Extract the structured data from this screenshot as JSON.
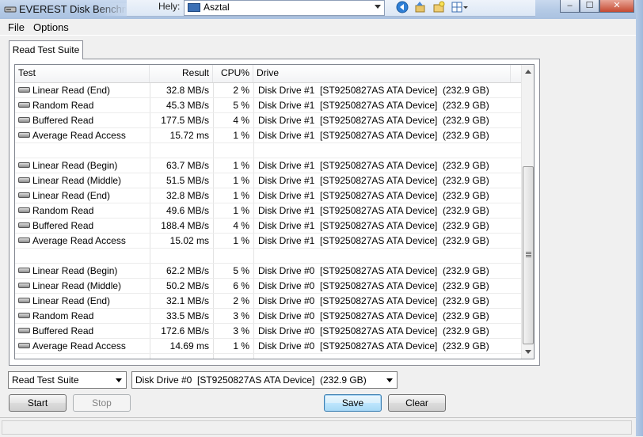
{
  "window": {
    "title": "EVEREST Disk Benchmark",
    "location_label": "Hely:",
    "location_value": "Asztal",
    "controls": [
      "minimize",
      "maximize",
      "close"
    ]
  },
  "menu": {
    "items": [
      {
        "label": "File"
      },
      {
        "label": "Options"
      }
    ]
  },
  "tabs": [
    {
      "label": "Read Test Suite",
      "active": true
    }
  ],
  "table": {
    "columns": [
      "Test",
      "Result",
      "CPU%",
      "Drive"
    ],
    "rows": [
      {
        "test": "Linear Read (End)",
        "result": "32.8 MB/s",
        "cpu": "2 %",
        "drive": "Disk Drive #1  [ST9250827AS ATA Device]  (232.9 GB)"
      },
      {
        "test": "Random Read",
        "result": "45.3 MB/s",
        "cpu": "5 %",
        "drive": "Disk Drive #1  [ST9250827AS ATA Device]  (232.9 GB)"
      },
      {
        "test": "Buffered Read",
        "result": "177.5 MB/s",
        "cpu": "4 %",
        "drive": "Disk Drive #1  [ST9250827AS ATA Device]  (232.9 GB)"
      },
      {
        "test": "Average Read Access",
        "result": "15.72 ms",
        "cpu": "1 %",
        "drive": "Disk Drive #1  [ST9250827AS ATA Device]  (232.9 GB)"
      },
      {
        "test": "",
        "result": "",
        "cpu": "",
        "drive": ""
      },
      {
        "test": "Linear Read (Begin)",
        "result": "63.7 MB/s",
        "cpu": "1 %",
        "drive": "Disk Drive #1  [ST9250827AS ATA Device]  (232.9 GB)"
      },
      {
        "test": "Linear Read (Middle)",
        "result": "51.5 MB/s",
        "cpu": "1 %",
        "drive": "Disk Drive #1  [ST9250827AS ATA Device]  (232.9 GB)"
      },
      {
        "test": "Linear Read (End)",
        "result": "32.8 MB/s",
        "cpu": "1 %",
        "drive": "Disk Drive #1  [ST9250827AS ATA Device]  (232.9 GB)"
      },
      {
        "test": "Random Read",
        "result": "49.6 MB/s",
        "cpu": "1 %",
        "drive": "Disk Drive #1  [ST9250827AS ATA Device]  (232.9 GB)"
      },
      {
        "test": "Buffered Read",
        "result": "188.4 MB/s",
        "cpu": "4 %",
        "drive": "Disk Drive #1  [ST9250827AS ATA Device]  (232.9 GB)"
      },
      {
        "test": "Average Read Access",
        "result": "15.02 ms",
        "cpu": "1 %",
        "drive": "Disk Drive #1  [ST9250827AS ATA Device]  (232.9 GB)"
      },
      {
        "test": "",
        "result": "",
        "cpu": "",
        "drive": ""
      },
      {
        "test": "Linear Read (Begin)",
        "result": "62.2 MB/s",
        "cpu": "5 %",
        "drive": "Disk Drive #0  [ST9250827AS ATA Device]  (232.9 GB)"
      },
      {
        "test": "Linear Read (Middle)",
        "result": "50.2 MB/s",
        "cpu": "6 %",
        "drive": "Disk Drive #0  [ST9250827AS ATA Device]  (232.9 GB)"
      },
      {
        "test": "Linear Read (End)",
        "result": "32.1 MB/s",
        "cpu": "2 %",
        "drive": "Disk Drive #0  [ST9250827AS ATA Device]  (232.9 GB)"
      },
      {
        "test": "Random Read",
        "result": "33.5 MB/s",
        "cpu": "3 %",
        "drive": "Disk Drive #0  [ST9250827AS ATA Device]  (232.9 GB)"
      },
      {
        "test": "Buffered Read",
        "result": "172.6 MB/s",
        "cpu": "3 %",
        "drive": "Disk Drive #0  [ST9250827AS ATA Device]  (232.9 GB)"
      },
      {
        "test": "Average Read Access",
        "result": "14.69 ms",
        "cpu": "1 %",
        "drive": "Disk Drive #0  [ST9250827AS ATA Device]  (232.9 GB)"
      }
    ]
  },
  "controls": {
    "suite_select": "Read Test Suite",
    "drive_select": "Disk Drive #0  [ST9250827AS ATA Device]  (232.9 GB)",
    "start_label": "Start",
    "stop_label": "Stop",
    "save_label": "Save",
    "clear_label": "Clear"
  },
  "icons": {
    "app": "disk-drive-icon",
    "row": "hard-disk-icon",
    "toolbar": [
      "back-icon",
      "up-folder-icon",
      "new-folder-icon",
      "view-menu-icon"
    ]
  }
}
